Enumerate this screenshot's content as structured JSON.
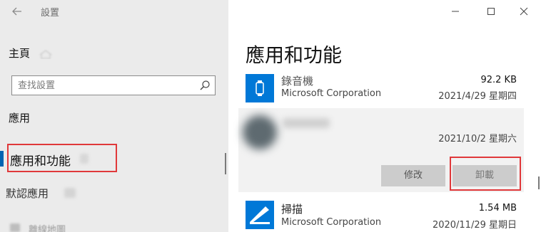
{
  "window": {
    "title": "設置"
  },
  "nav": {
    "home_label": "主頁",
    "search": {
      "placeholder": "查找設置",
      "value": ""
    },
    "category_label": "應用",
    "items": [
      {
        "label": "應用和功能",
        "selected": true
      },
      {
        "label": "默認應用",
        "selected": false
      },
      {
        "label": "離線地圖",
        "selected": false
      }
    ]
  },
  "main": {
    "title": "應用和功能",
    "apps": [
      {
        "name": "錄音機",
        "publisher": "Microsoft Corporation",
        "size": "92.2 KB",
        "date": "2021/4/29 星期四",
        "icon": "voice-recorder-icon"
      },
      {
        "name": "",
        "publisher": "",
        "size": "",
        "date": "2021/10/2 星期六",
        "icon": "blurred-app-icon",
        "expanded": true,
        "buttons": {
          "modify": "修改",
          "uninstall": "卸載"
        }
      },
      {
        "name": "掃描",
        "publisher": "Microsoft Corporation",
        "size": "1.54 MB",
        "date": "2020/11/29 星期日",
        "icon": "scanner-icon"
      }
    ]
  },
  "colors": {
    "accent": "#0063b1",
    "highlight": "#e0383a",
    "nav_bg": "#ebebeb",
    "expanded_row_bg": "#f2f2f2"
  }
}
